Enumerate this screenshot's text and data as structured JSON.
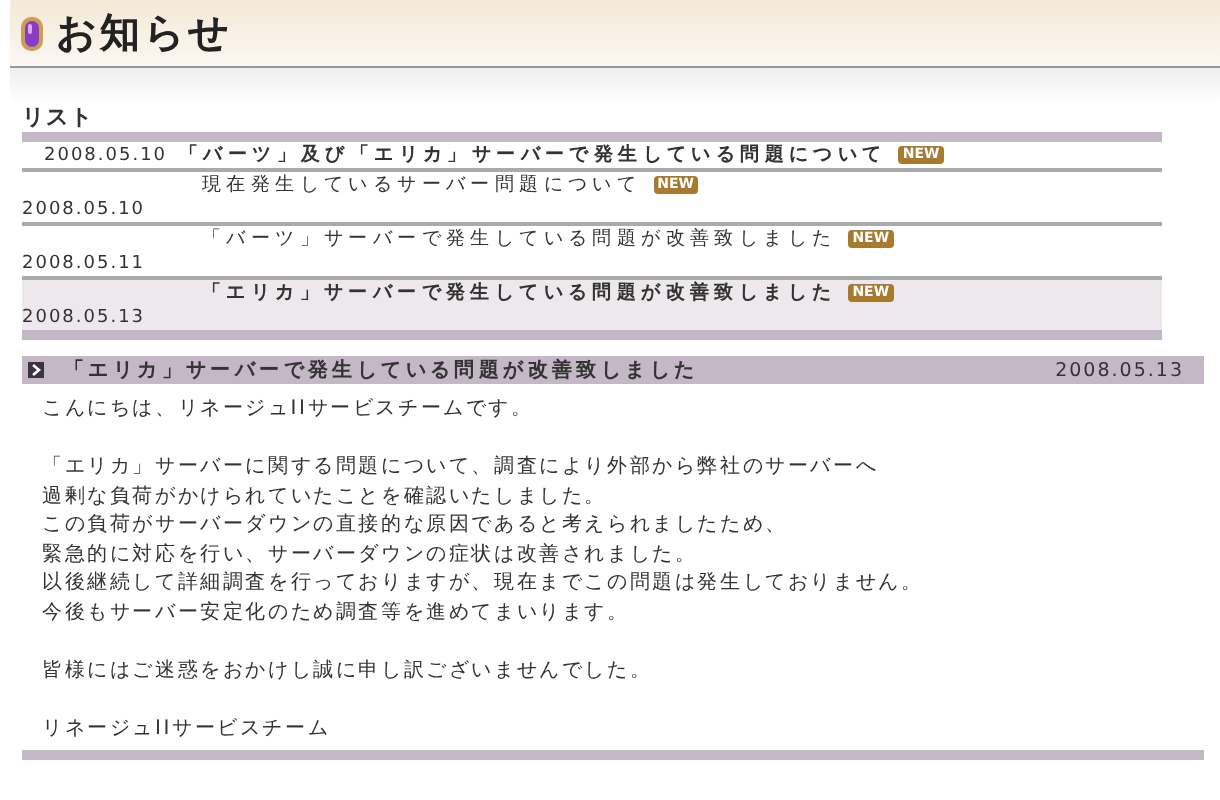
{
  "header": {
    "title": "お知らせ"
  },
  "list": {
    "heading": "リスト",
    "items": [
      {
        "kind": "inline",
        "date": "2008.05.10",
        "title": "「バーツ」及び「エリカ」サーバーで発生している問題について",
        "badge": "NEW",
        "unread": true,
        "selected": false
      },
      {
        "kind": "stacked",
        "date": "2008.05.10",
        "title": "現在発生しているサーバー問題について",
        "badge": "NEW",
        "unread": false,
        "selected": false
      },
      {
        "kind": "stacked",
        "date": "2008.05.11",
        "title": "「バーツ」サーバーで発生している問題が改善致しました",
        "badge": "NEW",
        "unread": false,
        "selected": false
      },
      {
        "kind": "stacked",
        "date": "2008.05.13",
        "title": "「エリカ」サーバーで発生している問題が改善致しました",
        "badge": "NEW",
        "unread": true,
        "selected": true
      }
    ]
  },
  "article": {
    "title": "「エリカ」サーバーで発生している問題が改善致しました",
    "date": "2008.05.13",
    "paragraphs": [
      [
        "こんにちは、リネージュIIサービスチームです。"
      ],
      [
        "「エリカ」サーバーに関する問題について、調査により外部から弊社のサーバーへ",
        "過剰な負荷がかけられていたことを確認いたしました。",
        "この負荷がサーバーダウンの直接的な原因であると考えられましたため、",
        "緊急的に対応を行い、サーバーダウンの症状は改善されました。",
        "以後継続して詳細調査を行っておりますが、現在までこの問題は発生しておりません。",
        "今後もサーバー安定化のため調査等を進めてまいります。"
      ],
      [
        "皆様にはご迷惑をおかけし誠に申し訳ございませんでした。"
      ],
      [
        "リネージュIIサービスチーム"
      ]
    ]
  }
}
